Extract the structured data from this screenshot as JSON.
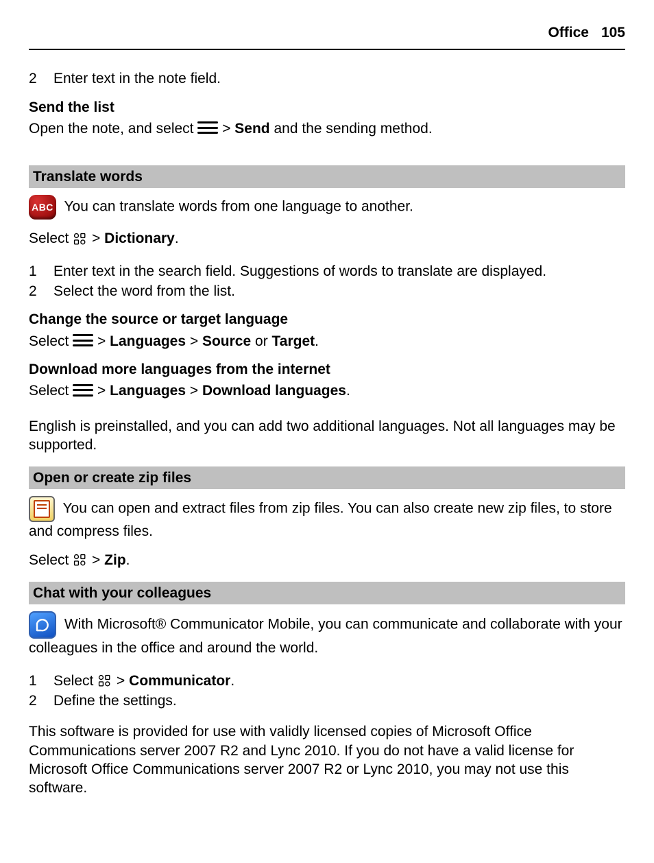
{
  "header": {
    "chapter": "Office",
    "page_number": "105"
  },
  "intro": {
    "step_num": "2",
    "step_text": "Enter text in the note field."
  },
  "send_list": {
    "heading": "Send the list",
    "pre": "Open the note, and select ",
    "arrow1": " > ",
    "bold1": "Send",
    "post": " and the sending method."
  },
  "translate": {
    "bar": "Translate words",
    "abc_label": "ABC",
    "intro": " You can translate words from one language to another.",
    "select_pre": "Select ",
    "arrow": " > ",
    "dictionary": "Dictionary",
    "period": ".",
    "steps": [
      {
        "n": "1",
        "t": "Enter text in the search field. Suggestions of words to translate are displayed."
      },
      {
        "n": "2",
        "t": "Select the word from the list."
      }
    ],
    "change_lang": {
      "heading": "Change the source or target language",
      "pre": "Select ",
      "arrow1": " > ",
      "languages": "Languages",
      "arrow2": "  > ",
      "source": "Source",
      "or": " or ",
      "target": "Target",
      "period": "."
    },
    "download": {
      "heading": "Download more languages from the internet",
      "pre": "Select ",
      "arrow1": " > ",
      "languages": "Languages",
      "arrow2": "  > ",
      "dl": "Download languages",
      "period": "."
    },
    "note": "English is preinstalled, and you can add two additional languages. Not all languages may be supported."
  },
  "zip": {
    "bar": "Open or create zip files",
    "intro": " You can open and extract files from zip files. You can also create new zip files, to store and compress files.",
    "select_pre": "Select ",
    "arrow": " > ",
    "zip_label": "Zip",
    "period": "."
  },
  "chat": {
    "bar": "Chat with your colleagues",
    "intro": " With Microsoft® Communicator Mobile, you can communicate and collaborate with your colleagues in the office and around the world.",
    "step1_n": "1",
    "step1_pre": "Select ",
    "step1_arrow": " > ",
    "step1_bold": "Communicator",
    "step1_period": ".",
    "step2_n": "2",
    "step2_t": "Define the settings.",
    "license": "This software is provided for use with validly licensed copies of Microsoft Office Communications server 2007 R2 and Lync 2010. If you do not have a valid license for Microsoft Office Communications server 2007 R2 or Lync 2010, you may not use this software."
  }
}
